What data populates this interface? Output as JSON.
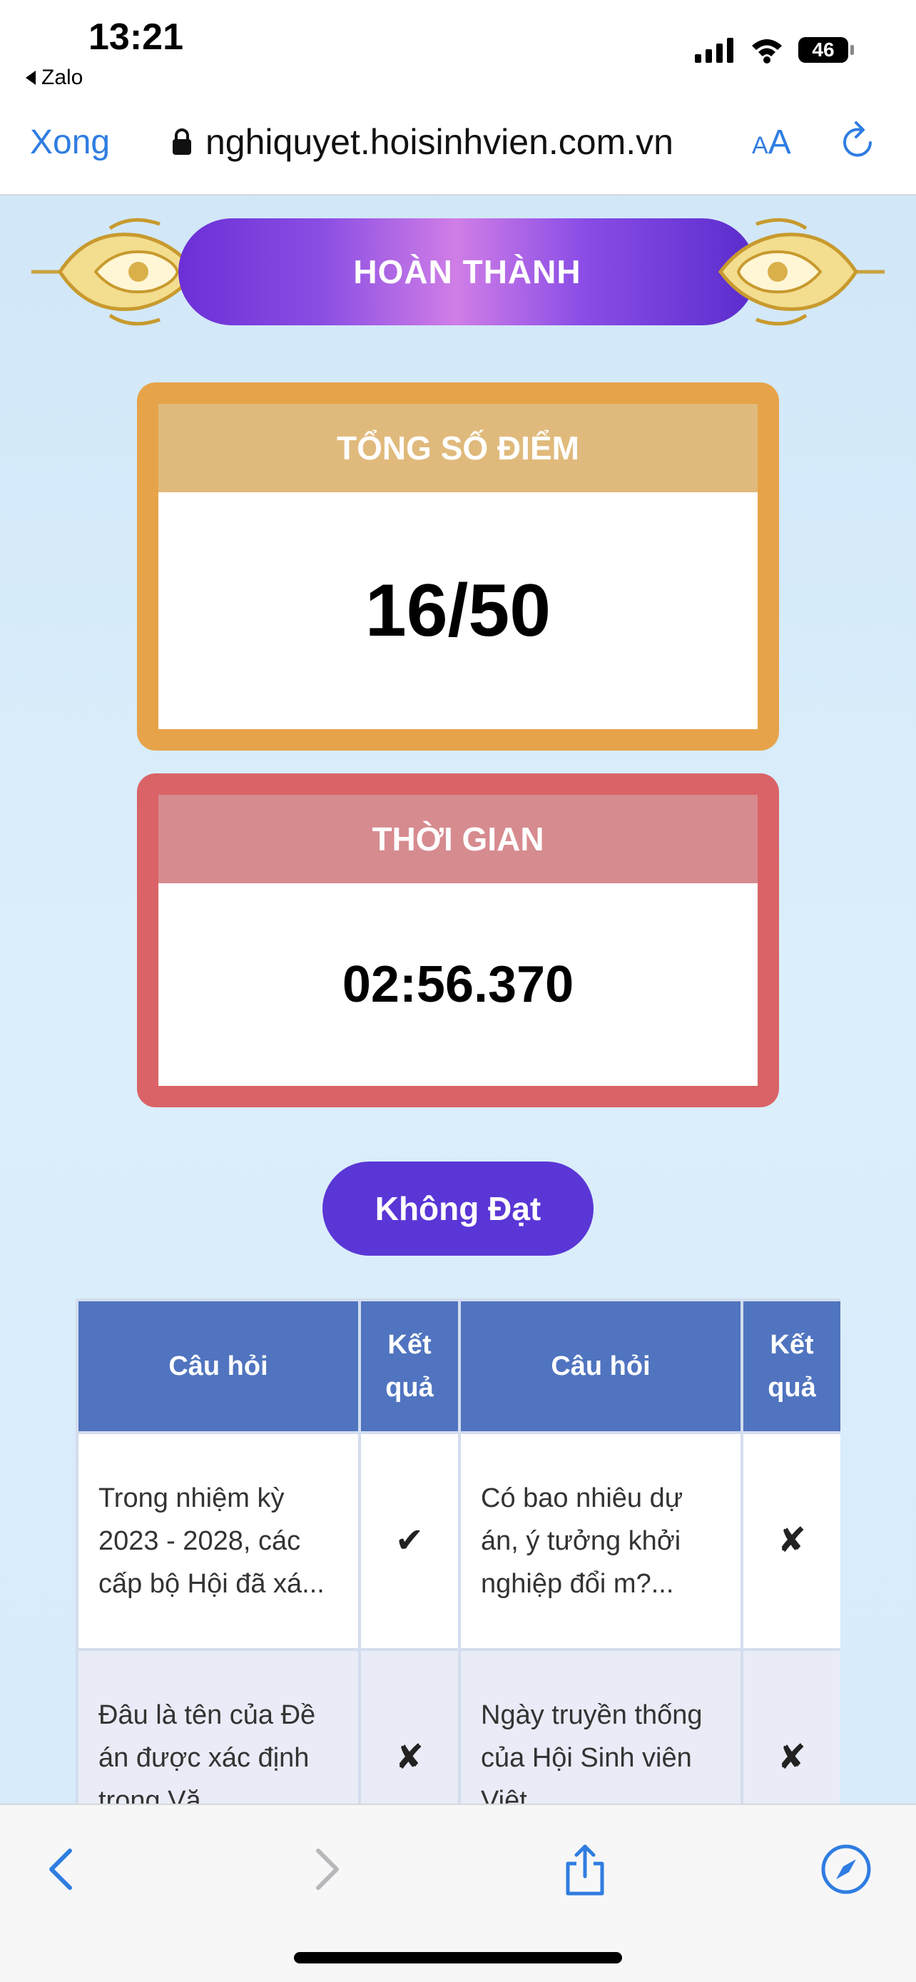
{
  "status_bar": {
    "time": "13:21",
    "back_app": "Zalo",
    "battery": "46"
  },
  "browser": {
    "done_label": "Xong",
    "url": "nghiquyet.hoisinhvien.com.vn",
    "text_size_label_small": "A",
    "text_size_label_large": "A"
  },
  "result": {
    "banner_title": "HOÀN THÀNH",
    "score_heading": "TỔNG SỐ ĐIỂM",
    "score_value": "16/50",
    "time_heading": "THỜI GIAN",
    "time_value": "02:56.370",
    "status_button": "Không Đạt"
  },
  "table": {
    "headers": [
      "Câu hỏi",
      "Kết quả",
      "Câu hỏi",
      "Kết quả"
    ],
    "rows": [
      {
        "q1": "Trong nhiệm kỳ 2023 - 2028, các cấp bộ Hội đã xá...",
        "r1": "✔",
        "q2": "Có bao nhiêu dự án, ý tưởng khởi nghiệp đổi m?...",
        "r2": "✘"
      },
      {
        "q1": "Đâu là tên của Đề án được xác định trong Vă...",
        "r1": "✘",
        "q2": "Ngày truyền thống của Hội Sinh viên Việt",
        "r2": "✘"
      }
    ]
  },
  "colors": {
    "accent_blue": "#2f7de1",
    "score_border": "#e7a34a",
    "time_border": "#d96366",
    "button_purple": "#5a36d6",
    "table_header": "#5074bf"
  }
}
